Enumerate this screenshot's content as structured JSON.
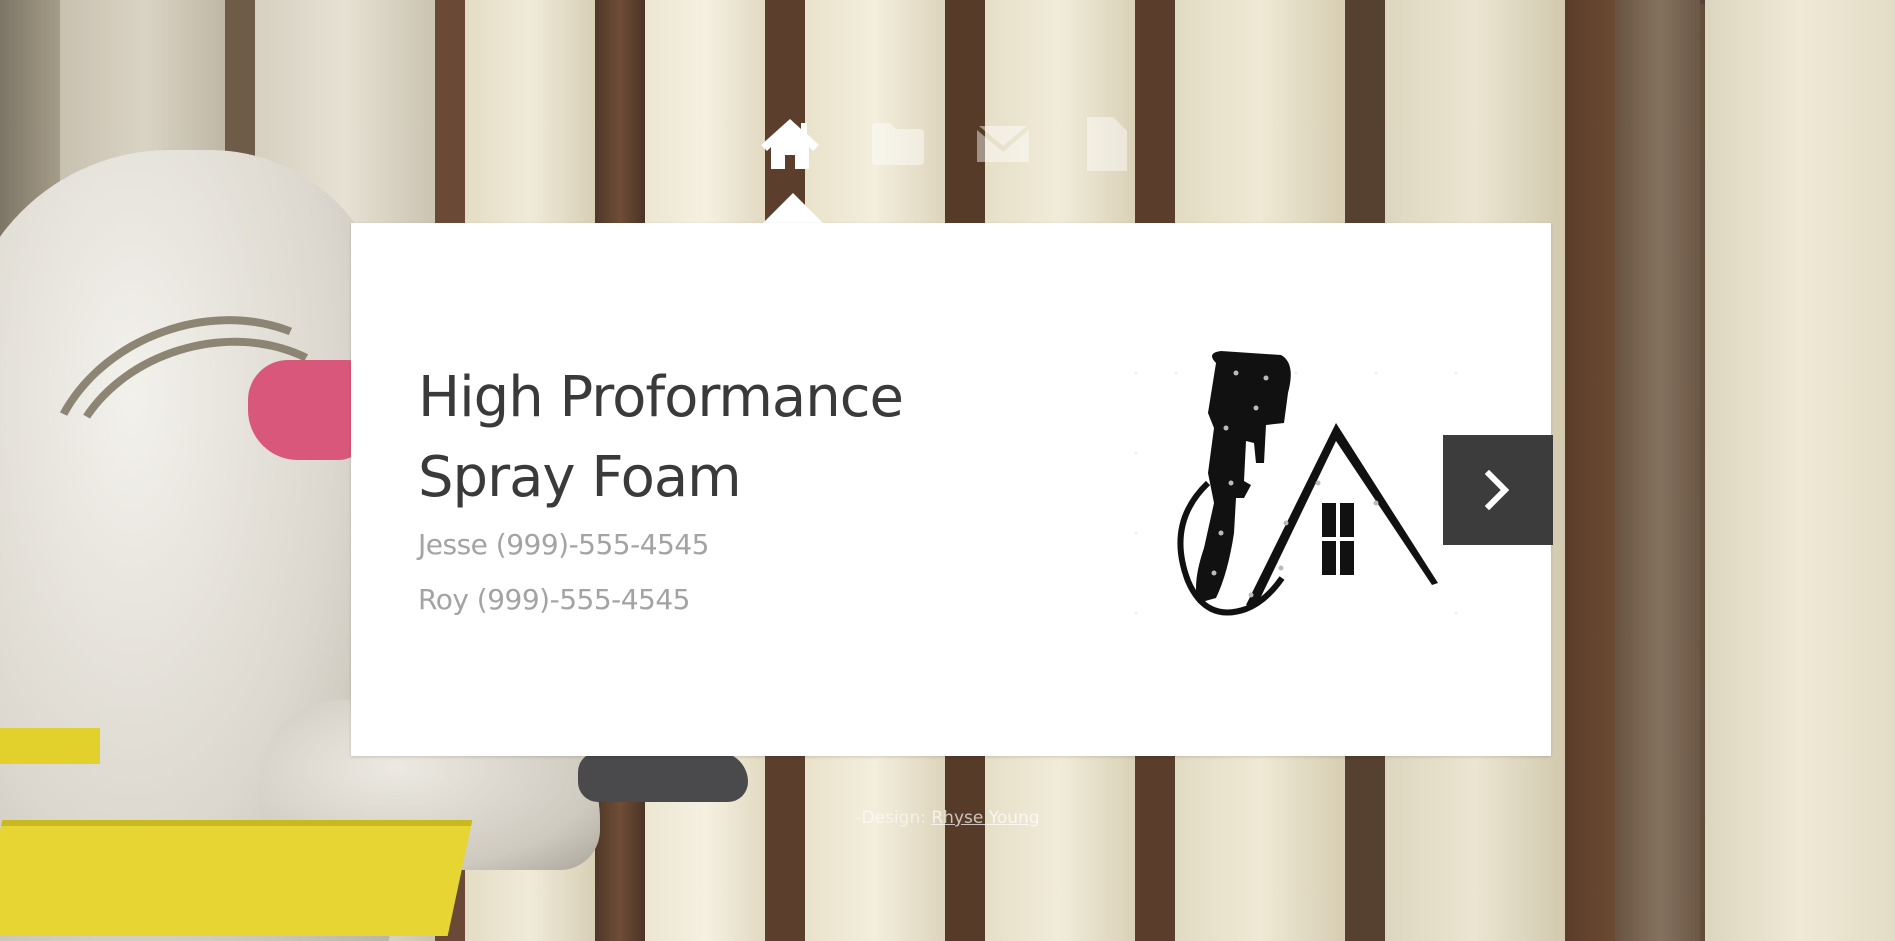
{
  "nav": {
    "items": [
      {
        "icon": "home-icon",
        "active": true
      },
      {
        "icon": "folder-icon",
        "active": false
      },
      {
        "icon": "envelope-icon",
        "active": false
      },
      {
        "icon": "document-icon",
        "active": false
      }
    ]
  },
  "panel": {
    "title_line1": "High Proformance",
    "title_line2": "Spray Foam",
    "contact_1": "Jesse (999)-555-4545",
    "contact_2": "Roy (999)-555-4545",
    "logo_icon": "spray-gun-house-logo",
    "next_icon": "chevron-right-icon"
  },
  "footer": {
    "credit_prefix": "-Design: ",
    "credit_link": "Rhyse Young"
  },
  "colors": {
    "panel_bg": "#ffffff",
    "title_text": "#3a3a3a",
    "contact_text": "#a3a3a3",
    "next_button_bg": "#3c3c3c"
  }
}
